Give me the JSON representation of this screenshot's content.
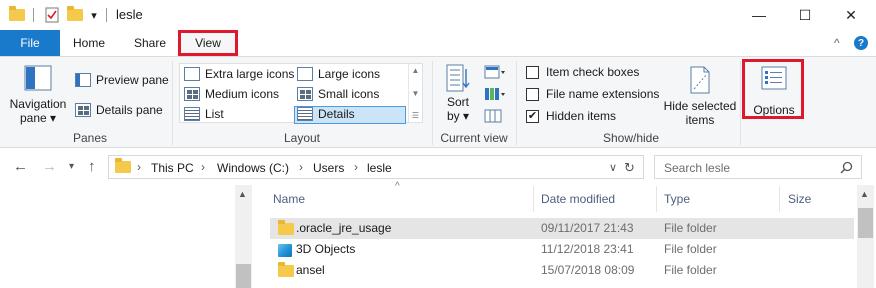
{
  "window": {
    "title": "lesle",
    "minimize": "—",
    "maximize": "☐",
    "close": "✕"
  },
  "quick_access": {
    "down_arrow": "▾"
  },
  "ribbon_tabs": {
    "file": "File",
    "home": "Home",
    "share": "Share",
    "view": "View",
    "collapse": "^",
    "help": "?"
  },
  "panes_group": {
    "navigation_pane": "Navigation",
    "navigation_pane_2": "pane ▾",
    "preview_pane": "Preview pane",
    "details_pane": "Details pane",
    "label": "Panes"
  },
  "layout_group": {
    "extra_large_icons": "Extra large icons",
    "large_icons": "Large icons",
    "medium_icons": "Medium icons",
    "small_icons": "Small icons",
    "list": "List",
    "details": "Details",
    "label": "Layout",
    "selected": "Details"
  },
  "current_view_group": {
    "sort_by": "Sort",
    "sort_by_2": "by ▾",
    "label": "Current view"
  },
  "show_hide_group": {
    "item_check_boxes": "Item check boxes",
    "file_name_extensions": "File name extensions",
    "hidden_items": "Hidden items",
    "item_check_boxes_checked": false,
    "file_name_extensions_checked": false,
    "hidden_items_checked": true,
    "hide_selected": "Hide selected",
    "hide_selected_2": "items",
    "label": "Show/hide"
  },
  "options_group": {
    "options": "Options"
  },
  "address_bar": {
    "crumbs": [
      "This PC",
      "Windows (C:)",
      "Users",
      "lesle"
    ],
    "search_placeholder": "Search lesle"
  },
  "file_list": {
    "sort_indicator": "^",
    "columns": {
      "name": "Name",
      "date_modified": "Date modified",
      "type": "Type",
      "size": "Size"
    },
    "rows": [
      {
        "name": ".oracle_jre_usage",
        "date": "09/11/2017 21:43",
        "type": "File folder",
        "icon": "folder-icon",
        "selected": true
      },
      {
        "name": "3D Objects",
        "date": "11/12/2018 23:41",
        "type": "File folder",
        "icon": "3d-objects-icon",
        "selected": false
      },
      {
        "name": "ansel",
        "date": "15/07/2018 08:09",
        "type": "File folder",
        "icon": "folder-icon",
        "selected": false
      }
    ]
  },
  "colors": {
    "accent": "#1979ca",
    "highlight_box": "#e0182b",
    "selected_row": "#e5e5e5"
  }
}
